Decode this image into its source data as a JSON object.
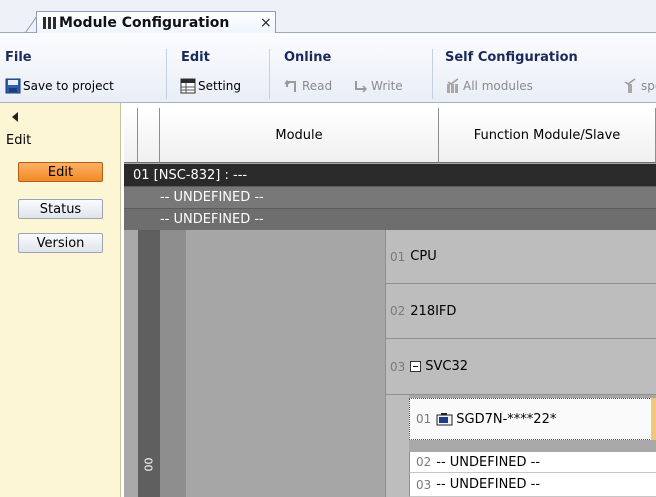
{
  "tab": {
    "title": "Module Configuration",
    "close": "×"
  },
  "ribbon": {
    "file": {
      "title": "File",
      "save_label": "Save to project"
    },
    "edit": {
      "title": "Edit",
      "setting_label": "Setting"
    },
    "online": {
      "title": "Online",
      "read_label": "Read",
      "write_label": "Write"
    },
    "self_configuration": {
      "title": "Self Configuration",
      "all_modules_label": "All modules",
      "specific_label": "spe"
    }
  },
  "left_panel": {
    "title": "Edit",
    "buttons": [
      {
        "label": "Edit",
        "active": true
      },
      {
        "label": "Status",
        "active": false
      },
      {
        "label": "Version",
        "active": false
      }
    ]
  },
  "grid": {
    "headers": {
      "module": "Module",
      "function": "Function Module/Slave"
    },
    "rows": {
      "controller": "01 [NSC-832] : ---",
      "undefined_1": "-- UNDEFINED --",
      "undefined_2": "-- UNDEFINED --"
    },
    "slot_label": "00",
    "function_modules": [
      {
        "num": "01",
        "name": "CPU"
      },
      {
        "num": "02",
        "name": "218IFD"
      },
      {
        "num": "03",
        "name": "SVC32"
      }
    ],
    "slaves": [
      {
        "num": "01",
        "name": "SGD7N-****22*"
      },
      {
        "num": "02",
        "name": "-- UNDEFINED --"
      },
      {
        "num": "03",
        "name": "-- UNDEFINED --"
      }
    ]
  },
  "colors": {
    "active_button": "#f08a24",
    "panel_bg": "#fdf6d4",
    "controller_row": "#2a2a2a"
  }
}
